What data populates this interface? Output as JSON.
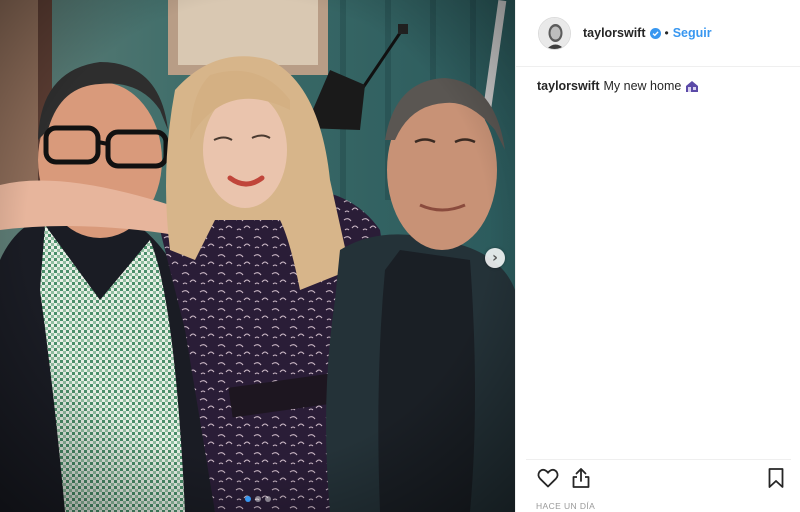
{
  "post": {
    "username": "taylorswift",
    "follow_label": "Seguir",
    "separator": "•",
    "caption_user": "taylorswift",
    "caption_text": "My new home",
    "caption_emoji": "house-emoji",
    "timestamp": "HACE UN DÍA",
    "carousel": {
      "total_slides": 3,
      "active_slide": 1
    }
  },
  "icons": {
    "verified": "verified-badge-icon",
    "next": "chevron-right-icon",
    "like": "heart-icon",
    "share": "share-icon",
    "save": "bookmark-icon"
  },
  "colors": {
    "link_blue": "#3897f0",
    "text": "#262626",
    "muted": "#999999",
    "border": "#efefef"
  }
}
